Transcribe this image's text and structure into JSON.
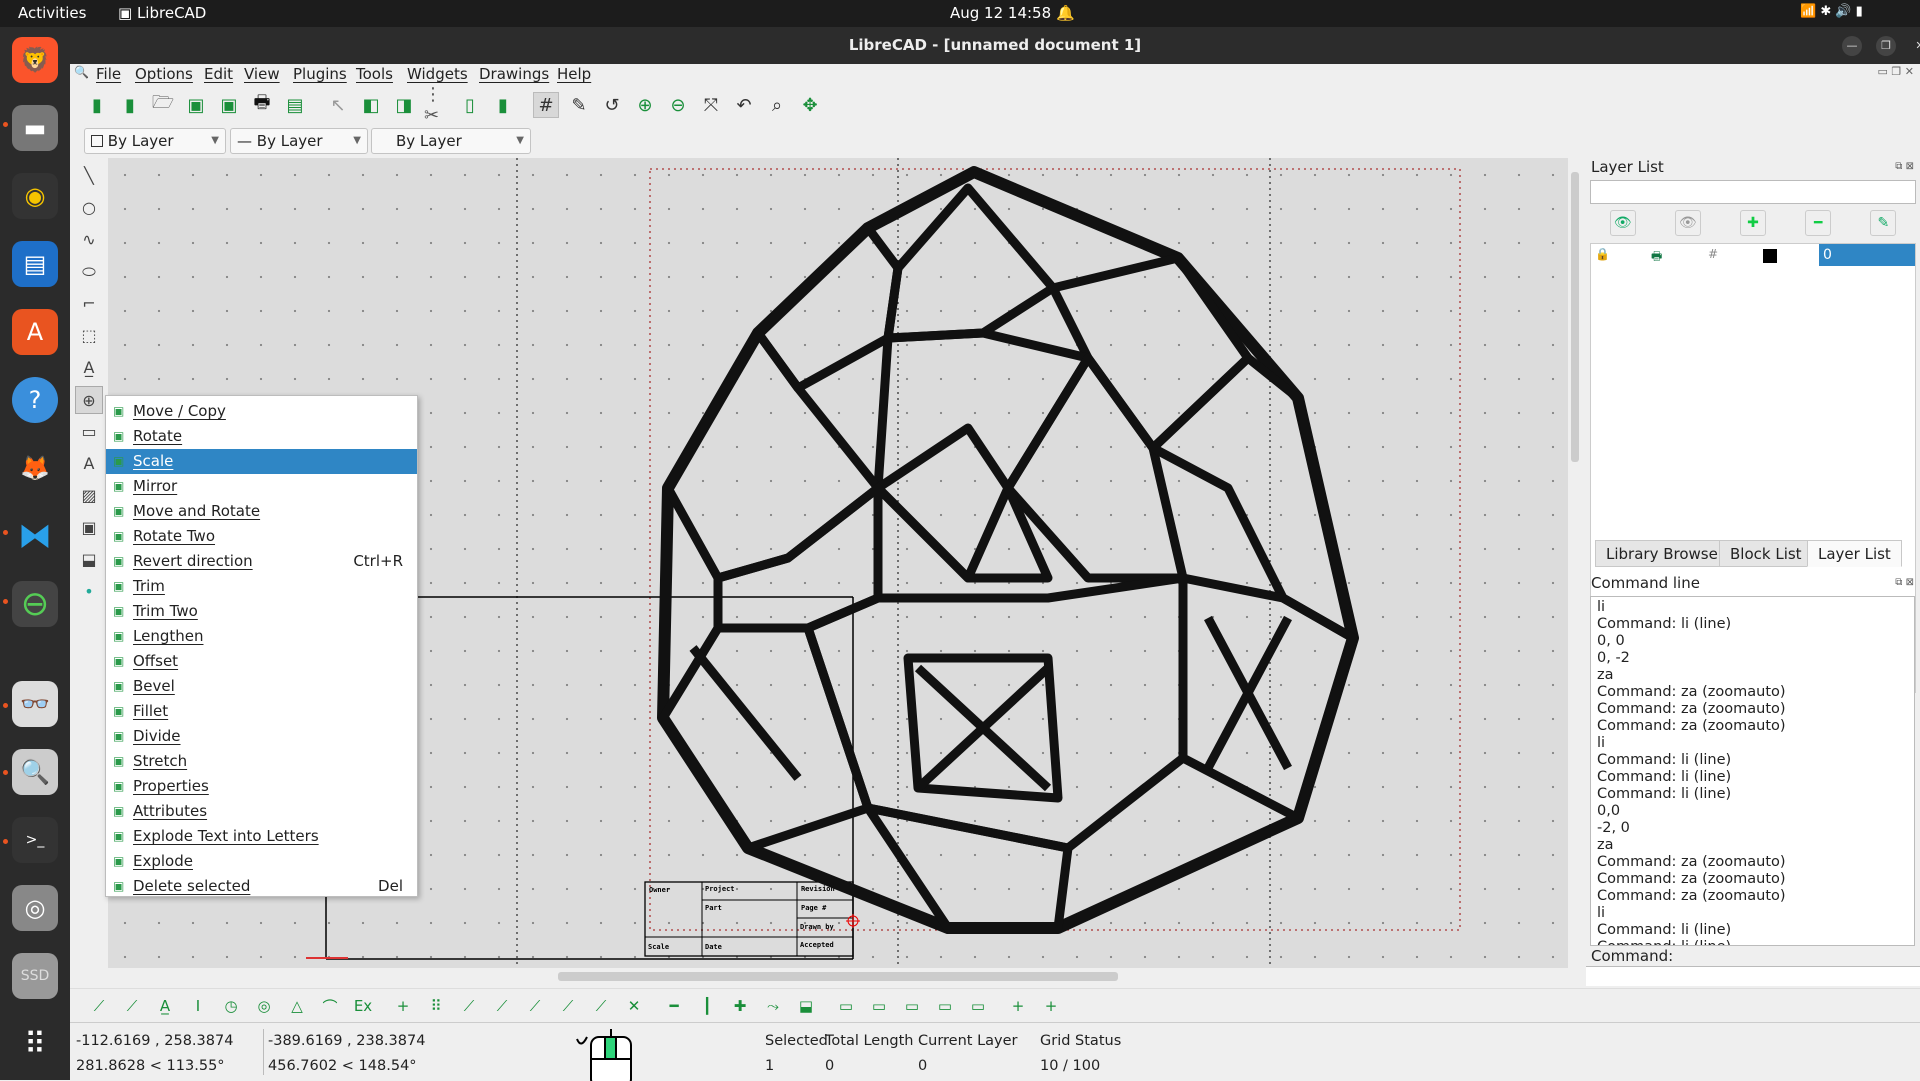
{
  "topbar": {
    "activities": "Activities",
    "app": "LibreCAD",
    "datetime": "Aug 12  14:58"
  },
  "dock": {
    "items": [
      "brave-browser",
      "files",
      "rhythmbox",
      "libreoffice-writer",
      "app-center",
      "help",
      "gimp",
      "vscode",
      "librecad",
      "document-viewer",
      "magnifier",
      "terminal",
      "disc",
      "ssd-drive",
      "show-apps"
    ],
    "ssd_label": "SSD"
  },
  "window": {
    "title": "LibreCAD - [unnamed document 1]"
  },
  "menu": [
    "File",
    "Options",
    "Edit",
    "View",
    "Plugins",
    "Tools",
    "Widgets",
    "Drawings",
    "Help"
  ],
  "pen_toolbar": {
    "color": "By Layer",
    "line_type": "By Layer",
    "line_width": "By Layer"
  },
  "context_menu": {
    "items": [
      {
        "label": "Move / Copy",
        "shortcut": ""
      },
      {
        "label": "Rotate",
        "shortcut": ""
      },
      {
        "label": "Scale",
        "shortcut": "",
        "highlighted": true
      },
      {
        "label": "Mirror",
        "shortcut": ""
      },
      {
        "label": "Move and Rotate",
        "shortcut": ""
      },
      {
        "label": "Rotate Two",
        "shortcut": ""
      },
      {
        "label": "Revert direction",
        "shortcut": "Ctrl+R"
      },
      {
        "label": "Trim",
        "shortcut": ""
      },
      {
        "label": "Trim Two",
        "shortcut": ""
      },
      {
        "label": "Lengthen",
        "shortcut": ""
      },
      {
        "label": "Offset",
        "shortcut": ""
      },
      {
        "label": "Bevel",
        "shortcut": ""
      },
      {
        "label": "Fillet",
        "shortcut": ""
      },
      {
        "label": "Divide",
        "shortcut": ""
      },
      {
        "label": "Stretch",
        "shortcut": ""
      },
      {
        "label": "Properties",
        "shortcut": ""
      },
      {
        "label": "Attributes",
        "shortcut": ""
      },
      {
        "label": "Explode Text into Letters",
        "shortcut": ""
      },
      {
        "label": "Explode",
        "shortcut": ""
      },
      {
        "label": "Delete selected",
        "shortcut": "Del"
      }
    ]
  },
  "title_block": {
    "owner": "Owner",
    "project": "Project",
    "revision": "Revision",
    "part": "Part",
    "page": "Page #",
    "drawn_by": "Drawn by",
    "scale": "Scale",
    "date": "Date",
    "accepted": "Accepted"
  },
  "layer_list": {
    "title": "Layer List",
    "search": "",
    "layers": [
      {
        "name": "0",
        "color": "#000000"
      }
    ]
  },
  "dock_tabs": [
    "Library Browser",
    "Block List",
    "Layer List"
  ],
  "active_dock_tab": "Layer List",
  "command_line": {
    "title": "Command line",
    "history": [
      "li",
      "Command: li (line)",
      "0, 0",
      "0, -2",
      "za",
      "Command: za (zoomauto)",
      "Command: za (zoomauto)",
      "Command: za (zoomauto)",
      "li",
      "Command: li (line)",
      "Command: li (line)",
      "Command: li (line)",
      "0,0",
      "-2, 0",
      "za",
      "Command: za (zoomauto)",
      "Command: za (zoomauto)",
      "Command: za (zoomauto)",
      "li",
      "Command: li (line)",
      "Command: li (line)"
    ],
    "prompt": "Command:",
    "input": ""
  },
  "status": {
    "abs_coord": "-112.6169 , 258.3874",
    "abs_polar": "281.8628 < 113.55°",
    "rel_coord": "-389.6169 , 238.3874",
    "rel_polar": "456.7602 < 148.54°",
    "selected_label": "Selected",
    "selected": "1",
    "total_length_label": "Total Length",
    "total_length": "0",
    "current_layer_label": "Current Layer",
    "current_layer": "0",
    "grid_status_label": "Grid Status",
    "grid_status": "10 / 100"
  }
}
